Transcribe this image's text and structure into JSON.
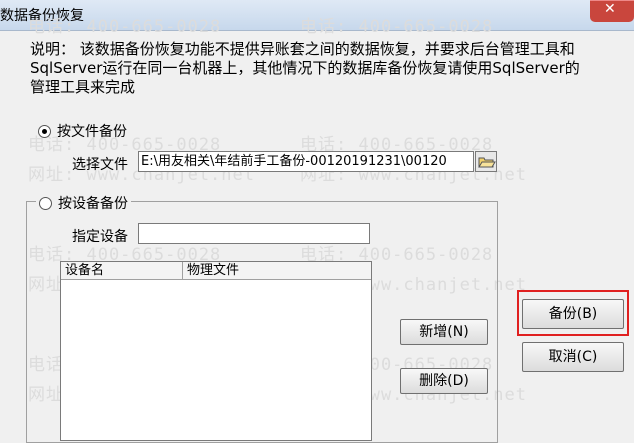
{
  "window": {
    "title": "数据备份恢复",
    "close_symbol": "✕"
  },
  "watermark": {
    "phone": "电话: 400-665-0028",
    "site": "网址: www.chanjet.net"
  },
  "description": "说明： 该数据备份恢复功能不提供异账套之间的数据恢复，并要求后台管理工具和SqlServer运行在同一台机器上，其他情况下的数据库备份恢复请使用SqlServer的管理工具来完成",
  "file_backup": {
    "radio_label": "按文件备份",
    "selected": true,
    "select_file_label": "选择文件",
    "file_path": "E:\\用友相关\\年结前手工备份-00120191231\\00120"
  },
  "device_backup": {
    "radio_label": "按设备备份",
    "selected": false,
    "device_label": "指定设备",
    "device_value": "",
    "columns": [
      "设备名",
      "物理文件"
    ],
    "rows": []
  },
  "buttons": {
    "add": "新增(N)",
    "delete": "删除(D)",
    "backup": "备份(B)",
    "cancel": "取消(C)"
  },
  "colors": {
    "highlight": "#e02020",
    "close": "#c9463d"
  }
}
